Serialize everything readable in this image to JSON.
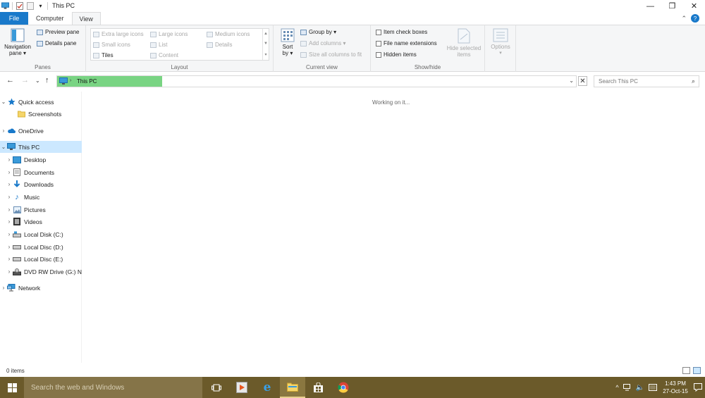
{
  "window": {
    "title": "This PC",
    "controls": {
      "minimize": "—",
      "restore": "❐",
      "close": "✕"
    }
  },
  "tabs": [
    {
      "label": "File"
    },
    {
      "label": "Computer"
    },
    {
      "label": "View"
    }
  ],
  "ribbon": {
    "panes": {
      "label": "Panes",
      "navigation_pane": "Navigation\npane ▾",
      "preview_pane": "Preview pane",
      "details_pane": "Details pane"
    },
    "layout": {
      "label": "Layout",
      "extra_large_icons": "Extra large icons",
      "large_icons": "Large icons",
      "medium_icons": "Medium icons",
      "small_icons": "Small icons",
      "list": "List",
      "details": "Details",
      "tiles": "Tiles",
      "content": "Content"
    },
    "current_view": {
      "label": "Current view",
      "sort_by": "Sort\nby ▾",
      "group_by": "Group by ▾",
      "add_columns": "Add columns ▾",
      "size_all_columns": "Size all columns to fit"
    },
    "show_hide": {
      "label": "Show/hide",
      "item_check_boxes": "Item check boxes",
      "file_name_extensions": "File name extensions",
      "hidden_items": "Hidden items",
      "hide_selected_items": "Hide selected\nitems"
    },
    "options": {
      "label": "Options"
    }
  },
  "address": {
    "path": "This PC"
  },
  "search": {
    "placeholder": "Search This PC"
  },
  "nav_pane": [
    {
      "label": "Quick access",
      "icon": "star-icon",
      "expander": "⌄"
    },
    {
      "label": "Screenshots",
      "icon": "folder-icon",
      "expander": ""
    },
    {
      "label": "OneDrive",
      "icon": "cloud-icon",
      "expander": "›"
    },
    {
      "label": "This PC",
      "icon": "monitor-icon",
      "expander": "⌄"
    },
    {
      "label": "Desktop",
      "icon": "desktop-icon",
      "expander": "›"
    },
    {
      "label": "Documents",
      "icon": "documents-icon",
      "expander": "›"
    },
    {
      "label": "Downloads",
      "icon": "download-icon",
      "expander": "›"
    },
    {
      "label": "Music",
      "icon": "music-icon",
      "expander": "›"
    },
    {
      "label": "Pictures",
      "icon": "pictures-icon",
      "expander": "›"
    },
    {
      "label": "Videos",
      "icon": "videos-icon",
      "expander": "›"
    },
    {
      "label": "Local Disk (C:)",
      "icon": "drive-icon",
      "expander": "›"
    },
    {
      "label": "Local Disc (D:)",
      "icon": "drive-icon",
      "expander": "›"
    },
    {
      "label": "Local Disc (E:)",
      "icon": "drive-icon",
      "expander": "›"
    },
    {
      "label": "DVD RW Drive (G:) N",
      "icon": "dvd-icon",
      "expander": "›"
    },
    {
      "label": "Network",
      "icon": "network-icon",
      "expander": "›"
    }
  ],
  "content": {
    "message": "Working on it..."
  },
  "status": {
    "items": "0 items"
  },
  "taskbar": {
    "search_placeholder": "Search the web and Windows",
    "time": "1:43 PM",
    "date": "27-Oct-15"
  },
  "colors": {
    "accent": "#1979ca",
    "address_progress": "#79d483",
    "selection": "#cce8ff",
    "taskbar": "#6b5a2a"
  }
}
